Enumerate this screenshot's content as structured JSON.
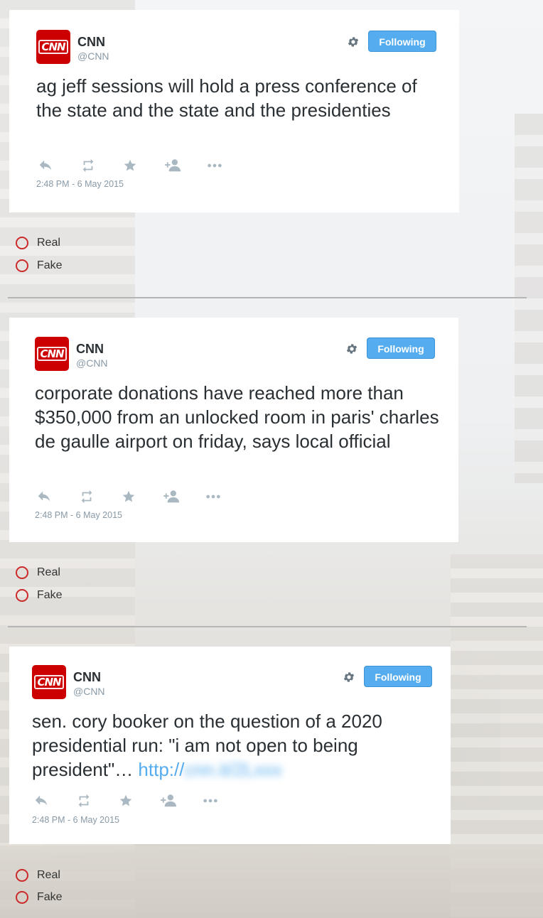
{
  "tweets": [
    {
      "avatar_text": "CNN",
      "name": "CNN",
      "handle": "@CNN",
      "follow_label": "Following",
      "text": "ag jeff sessions will hold a press conference of the state and the state and the presidenties",
      "link": "",
      "timestamp": "2:48 PM - 6 May 2015",
      "options": [
        "Real",
        "Fake"
      ]
    },
    {
      "avatar_text": "CNN",
      "name": "CNN",
      "handle": "@CNN",
      "follow_label": "Following",
      "text": "corporate donations have reached more than $350,000 from an unlocked room in paris' charles de gaulle airport on friday, says local official",
      "link": "",
      "timestamp": "2:48 PM - 6 May 2015",
      "options": [
        "Real",
        "Fake"
      ]
    },
    {
      "avatar_text": "CNN",
      "name": "CNN",
      "handle": "@CNN",
      "follow_label": "Following",
      "text": "sen. cory booker on the question of a 2020 presidential run: \"i am not open to being president\"… ",
      "link": "http://",
      "link_blurred": "cnn.it/2Lxxx",
      "timestamp": "2:48 PM - 6 May 2015",
      "options": [
        "Real",
        "Fake"
      ]
    }
  ],
  "icons": {
    "brand_color": "#cc0000",
    "accent": "#55acee",
    "radio_color": "#cc2a2a",
    "action_icons": [
      "reply-icon",
      "retweet-icon",
      "favorite-icon",
      "follow-user-icon",
      "more-icon"
    ]
  }
}
